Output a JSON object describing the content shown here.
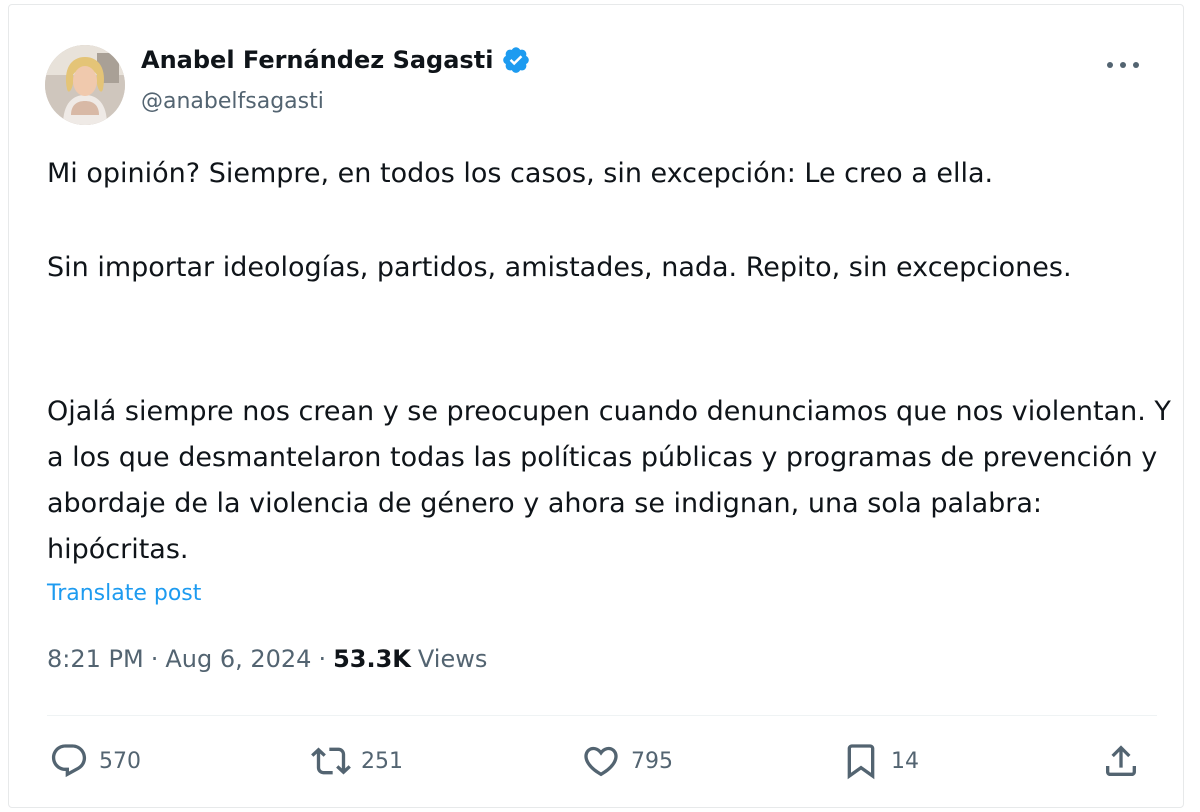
{
  "author": {
    "name": "Anabel Fernández Sagasti",
    "handle": "@anabelfsagasti",
    "verified": true,
    "verified_color": "#1d9bf0"
  },
  "post": {
    "paragraphs": [
      "Mi opinión? Siempre, en todos los casos, sin excepción: Le creo a ella.",
      "Sin importar ideologías, partidos, amistades, nada. Repito, sin excepciones.",
      "Ojalá siempre nos crean y se preocupen cuando denunciamos que nos violentan. Y a los que desmantelaron todas las políticas públicas y programas de prevención y abordaje de la violencia de género y ahora se indignan, una sola palabra: hipócritas."
    ],
    "translate_label": "Translate post"
  },
  "meta": {
    "time": "8:21 PM",
    "date": "Aug 6, 2024",
    "separator": "·",
    "views_count": "53.3K",
    "views_label": "Views"
  },
  "actions": {
    "replies": "570",
    "reposts": "251",
    "likes": "795",
    "bookmarks": "14"
  },
  "icons": {
    "more": "more-horizontal-icon",
    "reply": "reply-bubble-icon",
    "repost": "repost-icon",
    "like": "heart-icon",
    "bookmark": "bookmark-icon",
    "share": "share-icon",
    "verified": "verified-badge-icon"
  },
  "colors": {
    "text": "#0f1419",
    "muted": "#536471",
    "link": "#1d9bf0"
  }
}
